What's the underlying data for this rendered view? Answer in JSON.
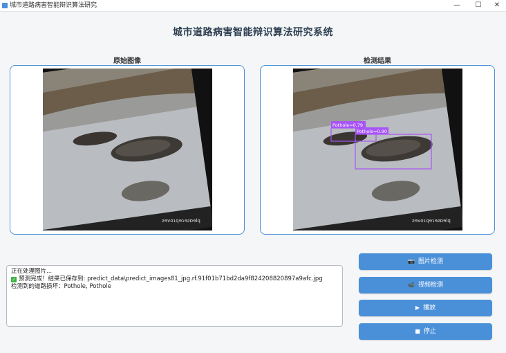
{
  "window": {
    "title": "城市道路病害智能辩识算法研究",
    "min_glyph": "—",
    "max_glyph": "☐",
    "close_glyph": "✕"
  },
  "header": {
    "title": "城市道路病害智能辩识算法研究系统"
  },
  "panels": {
    "original_label": "原始图像",
    "result_label": "检测结果"
  },
  "detections": [
    {
      "label": "Pothole=0.79",
      "color": "#a855f7"
    },
    {
      "label": "Pothole=0.90",
      "color": "#a855f7"
    }
  ],
  "watermark": "ƨɘvoɿqɘɿɘƨɒɘlq",
  "log": {
    "line1": "正在处理图片...",
    "line2": "预测完成！结果已保存到: predict_data\\predict_images81_jpg.rf.91f01b71bd2da9f824208820897a9afc.jpg",
    "line3": "检测到的道路损坏：Pothole, Pothole"
  },
  "buttons": {
    "image_detect": "图片检测",
    "video_detect": "视频检测",
    "play": "播放",
    "stop": "停止"
  },
  "icons": {
    "image_detect": "📷",
    "video_detect": "📹",
    "play": "▶",
    "stop": "■"
  },
  "colors": {
    "accent": "#4a90d9",
    "detection_box": "#a855f7"
  }
}
